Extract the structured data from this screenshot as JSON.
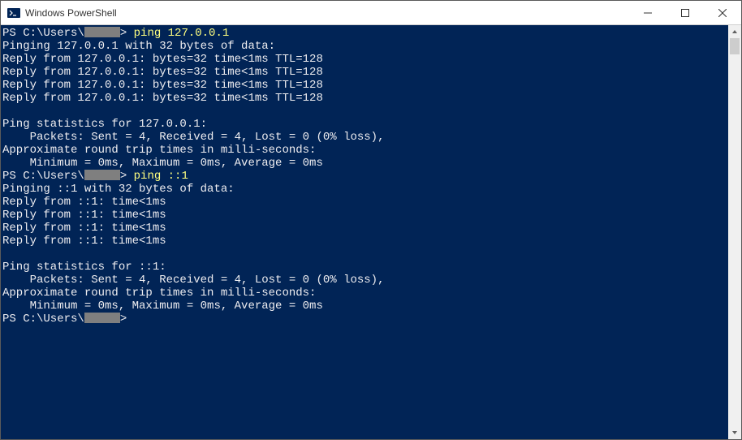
{
  "window": {
    "title": "Windows PowerShell"
  },
  "prompt": {
    "prefix": "PS C:\\Users\\",
    "suffix": ">"
  },
  "commands": {
    "cmd1": " ping 127.0.0.1",
    "cmd2": " ping ::1"
  },
  "output1": {
    "header": "Pinging 127.0.0.1 with 32 bytes of data:",
    "reply1": "Reply from 127.0.0.1: bytes=32 time<1ms TTL=128",
    "reply2": "Reply from 127.0.0.1: bytes=32 time<1ms TTL=128",
    "reply3": "Reply from 127.0.0.1: bytes=32 time<1ms TTL=128",
    "reply4": "Reply from 127.0.0.1: bytes=32 time<1ms TTL=128",
    "stats_header": "Ping statistics for 127.0.0.1:",
    "packets": "    Packets: Sent = 4, Received = 4, Lost = 0 (0% loss),",
    "approx": "Approximate round trip times in milli-seconds:",
    "times": "    Minimum = 0ms, Maximum = 0ms, Average = 0ms"
  },
  "output2": {
    "header": "Pinging ::1 with 32 bytes of data:",
    "reply1": "Reply from ::1: time<1ms",
    "reply2": "Reply from ::1: time<1ms",
    "reply3": "Reply from ::1: time<1ms",
    "reply4": "Reply from ::1: time<1ms",
    "stats_header": "Ping statistics for ::1:",
    "packets": "    Packets: Sent = 4, Received = 4, Lost = 0 (0% loss),",
    "approx": "Approximate round trip times in milli-seconds:",
    "times": "    Minimum = 0ms, Maximum = 0ms, Average = 0ms"
  }
}
